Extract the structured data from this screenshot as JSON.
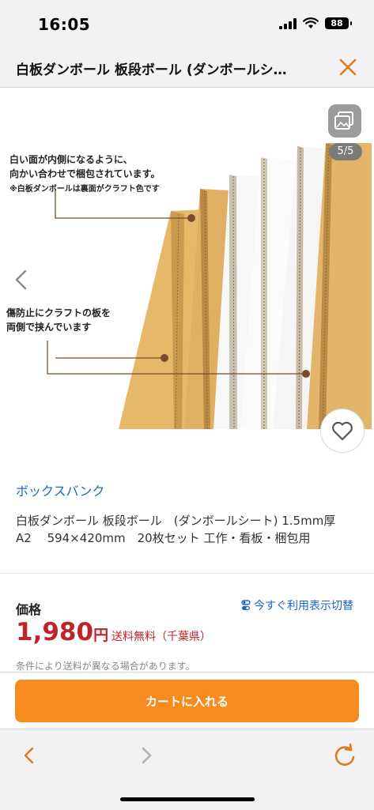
{
  "status": {
    "time": "16:05",
    "battery": "88"
  },
  "header": {
    "title": "白板ダンボール 板段ボール (ダンボールシ…"
  },
  "gallery": {
    "counter": "5/5",
    "annotation_top_1": "白い面が内側になるように、",
    "annotation_top_2": "向かい合わせで梱包されています。",
    "annotation_top_3": "※白板ダンボールは裏面がクラフト色です",
    "annotation_mid_1": "傷防止にクラフトの板を",
    "annotation_mid_2": "両側で挟んでいます"
  },
  "product": {
    "store": "ボックスバンク",
    "title": "白板ダンボール 板段ボール　(ダンボールシート) 1.5mm厚　A2　 594×420mm　20枚セット 工作・看板・梱包用"
  },
  "pricing": {
    "label": "価格",
    "toggle": "今すぐ利用表示切替",
    "amount": "1,980",
    "currency": "円",
    "shipping": "送料無料（千葉県）",
    "note": "条件により送料が異なる場合があります。"
  },
  "cart": {
    "button": "カートに入れる"
  },
  "colors": {
    "accent": "#f68b1f",
    "price": "#c0242b",
    "link": "#1a66c8"
  }
}
